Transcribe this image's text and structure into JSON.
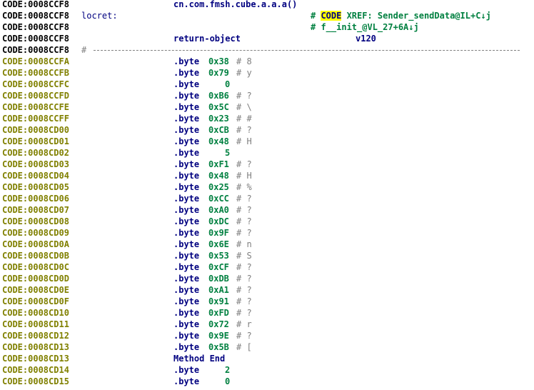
{
  "header_lines": [
    {
      "addr": "CODE:0008CCF8",
      "text": "cn.com.fmsh.cube.a.a.a()"
    },
    {
      "addr": "CODE:0008CCF8",
      "label": "locret:",
      "xref_prefix": "# ",
      "xref_hl": "CODE",
      "xref_rest": " XREF: Sender_sendData@IL+C↓j"
    },
    {
      "addr": "CODE:0008CCF8",
      "xref_prefix": "# f__init_@VL_27+6A↓j"
    },
    {
      "addr": "CODE:0008CCF8",
      "text": "return-object",
      "extra": "v120"
    },
    {
      "addr": "CODE:0008CCF8",
      "sep": "#"
    }
  ],
  "rows": [
    {
      "addr": "CODE:0008CCFA",
      "op": ".byte",
      "val": "0x38",
      "cmt": "# 8"
    },
    {
      "addr": "CODE:0008CCFB",
      "op": ".byte",
      "val": "0x79",
      "cmt": "# y"
    },
    {
      "addr": "CODE:0008CCFC",
      "op": ".byte",
      "val": "0",
      "cmt": ""
    },
    {
      "addr": "CODE:0008CCFD",
      "op": ".byte",
      "val": "0xB6",
      "cmt": "# ?"
    },
    {
      "addr": "CODE:0008CCFE",
      "op": ".byte",
      "val": "0x5C",
      "cmt": "# \\"
    },
    {
      "addr": "CODE:0008CCFF",
      "op": ".byte",
      "val": "0x23",
      "cmt": "# #"
    },
    {
      "addr": "CODE:0008CD00",
      "op": ".byte",
      "val": "0xCB",
      "cmt": "# ?"
    },
    {
      "addr": "CODE:0008CD01",
      "op": ".byte",
      "val": "0x48",
      "cmt": "# H"
    },
    {
      "addr": "CODE:0008CD02",
      "op": ".byte",
      "val": "5",
      "cmt": ""
    },
    {
      "addr": "CODE:0008CD03",
      "op": ".byte",
      "val": "0xF1",
      "cmt": "# ?"
    },
    {
      "addr": "CODE:0008CD04",
      "op": ".byte",
      "val": "0x48",
      "cmt": "# H"
    },
    {
      "addr": "CODE:0008CD05",
      "op": ".byte",
      "val": "0x25",
      "cmt": "# %"
    },
    {
      "addr": "CODE:0008CD06",
      "op": ".byte",
      "val": "0xCC",
      "cmt": "# ?"
    },
    {
      "addr": "CODE:0008CD07",
      "op": ".byte",
      "val": "0xA0",
      "cmt": "# ?"
    },
    {
      "addr": "CODE:0008CD08",
      "op": ".byte",
      "val": "0xDC",
      "cmt": "# ?"
    },
    {
      "addr": "CODE:0008CD09",
      "op": ".byte",
      "val": "0x9F",
      "cmt": "# ?"
    },
    {
      "addr": "CODE:0008CD0A",
      "op": ".byte",
      "val": "0x6E",
      "cmt": "# n"
    },
    {
      "addr": "CODE:0008CD0B",
      "op": ".byte",
      "val": "0x53",
      "cmt": "# S"
    },
    {
      "addr": "CODE:0008CD0C",
      "op": ".byte",
      "val": "0xCF",
      "cmt": "# ?"
    },
    {
      "addr": "CODE:0008CD0D",
      "op": ".byte",
      "val": "0xDB",
      "cmt": "# ?"
    },
    {
      "addr": "CODE:0008CD0E",
      "op": ".byte",
      "val": "0xA1",
      "cmt": "# ?"
    },
    {
      "addr": "CODE:0008CD0F",
      "op": ".byte",
      "val": "0x91",
      "cmt": "# ?"
    },
    {
      "addr": "CODE:0008CD10",
      "op": ".byte",
      "val": "0xFD",
      "cmt": "# ?"
    },
    {
      "addr": "CODE:0008CD11",
      "op": ".byte",
      "val": "0x72",
      "cmt": "# r"
    },
    {
      "addr": "CODE:0008CD12",
      "op": ".byte",
      "val": "0x9E",
      "cmt": "# ?"
    },
    {
      "addr": "CODE:0008CD13",
      "op": ".byte",
      "val": "0x5B",
      "cmt": "# ["
    },
    {
      "addr": "CODE:0008CD13",
      "op": "Method End",
      "val": "",
      "cmt": ""
    },
    {
      "addr": "CODE:0008CD14",
      "op": ".byte",
      "val": "2",
      "cmt": ""
    },
    {
      "addr": "CODE:0008CD15",
      "op": ".byte",
      "val": "0",
      "cmt": ""
    }
  ],
  "colors": {
    "addr_header": "#000000",
    "addr_data": "#808000",
    "mnemonic": "#000080",
    "number": "#008040",
    "comment": "#808080",
    "xref_highlight": "#ffff00"
  }
}
